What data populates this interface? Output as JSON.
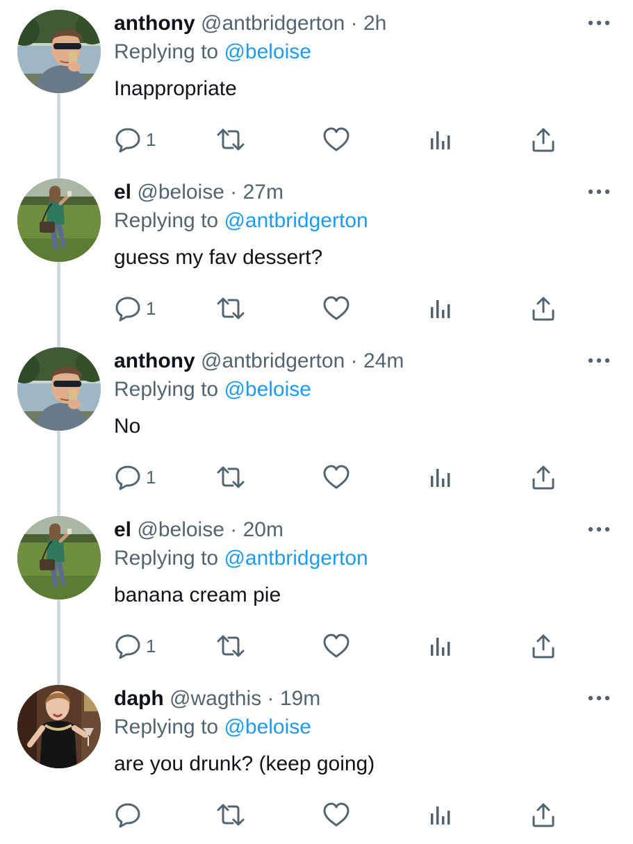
{
  "tweets": [
    {
      "display_name": "anthony",
      "handle": "@antbridgerton",
      "time": "2h",
      "replying_prefix": "Replying to",
      "replying_to": "@beloise",
      "text": "Inappropriate",
      "reply_count": "1",
      "avatar": "anthony-avatar"
    },
    {
      "display_name": "el",
      "handle": "@beloise",
      "time": "27m",
      "replying_prefix": "Replying to",
      "replying_to": "@antbridgerton",
      "text": "guess my fav dessert?",
      "reply_count": "1",
      "avatar": "el-avatar"
    },
    {
      "display_name": "anthony",
      "handle": "@antbridgerton",
      "time": "24m",
      "replying_prefix": "Replying to",
      "replying_to": "@beloise",
      "text": "No",
      "reply_count": "1",
      "avatar": "anthony-avatar"
    },
    {
      "display_name": "el",
      "handle": "@beloise",
      "time": "20m",
      "replying_prefix": "Replying to",
      "replying_to": "@antbridgerton",
      "text": "banana cream pie",
      "reply_count": "1",
      "avatar": "el-avatar"
    },
    {
      "display_name": "daph",
      "handle": "@wagthis",
      "time": "19m",
      "replying_prefix": "Replying to",
      "replying_to": "@beloise",
      "text": "are you drunk? (keep going)",
      "reply_count": "",
      "avatar": "daph-avatar"
    }
  ],
  "separator": "·",
  "icons": {
    "reply": "reply-icon",
    "retweet": "retweet-icon",
    "like": "heart-icon",
    "analytics": "analytics-icon",
    "share": "share-icon",
    "more": "more-icon"
  },
  "colors": {
    "text": "#0f1419",
    "secondary": "#536471",
    "link": "#1d9bf0",
    "thread_line": "#cfd9de"
  }
}
